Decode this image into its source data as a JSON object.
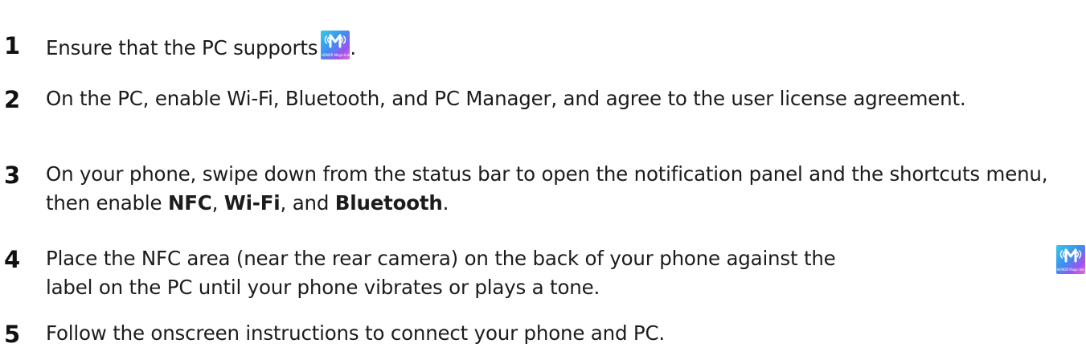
{
  "logo": {
    "icon": "honor-magic-link-icon",
    "caption": "HONOR Magic-link",
    "colors": [
      "#36c9ea",
      "#3d8ff0",
      "#9b54f0",
      "#e66acb"
    ]
  },
  "steps": [
    {
      "number": "1",
      "before_logo": "Ensure that the PC supports",
      "after_logo": "."
    },
    {
      "number": "2",
      "text": "On the PC, enable Wi-Fi, Bluetooth, and PC Manager, and agree to the user license agreement."
    },
    {
      "number": "3",
      "text_start": "On your phone, swipe down from the status bar to open the notification panel and the shortcuts menu, then enable ",
      "bold_1": "NFC",
      "sep_1": ", ",
      "bold_2": "Wi-Fi",
      "sep_2": ", and ",
      "bold_3": "Bluetooth",
      "text_end": "."
    },
    {
      "number": "4",
      "line_1": "Place the NFC area (near the rear camera) on the back of your phone against the",
      "line_2": "label on the PC until your phone vibrates or plays a tone."
    },
    {
      "number": "5",
      "text": "Follow the onscreen instructions to connect your phone and PC."
    }
  ]
}
